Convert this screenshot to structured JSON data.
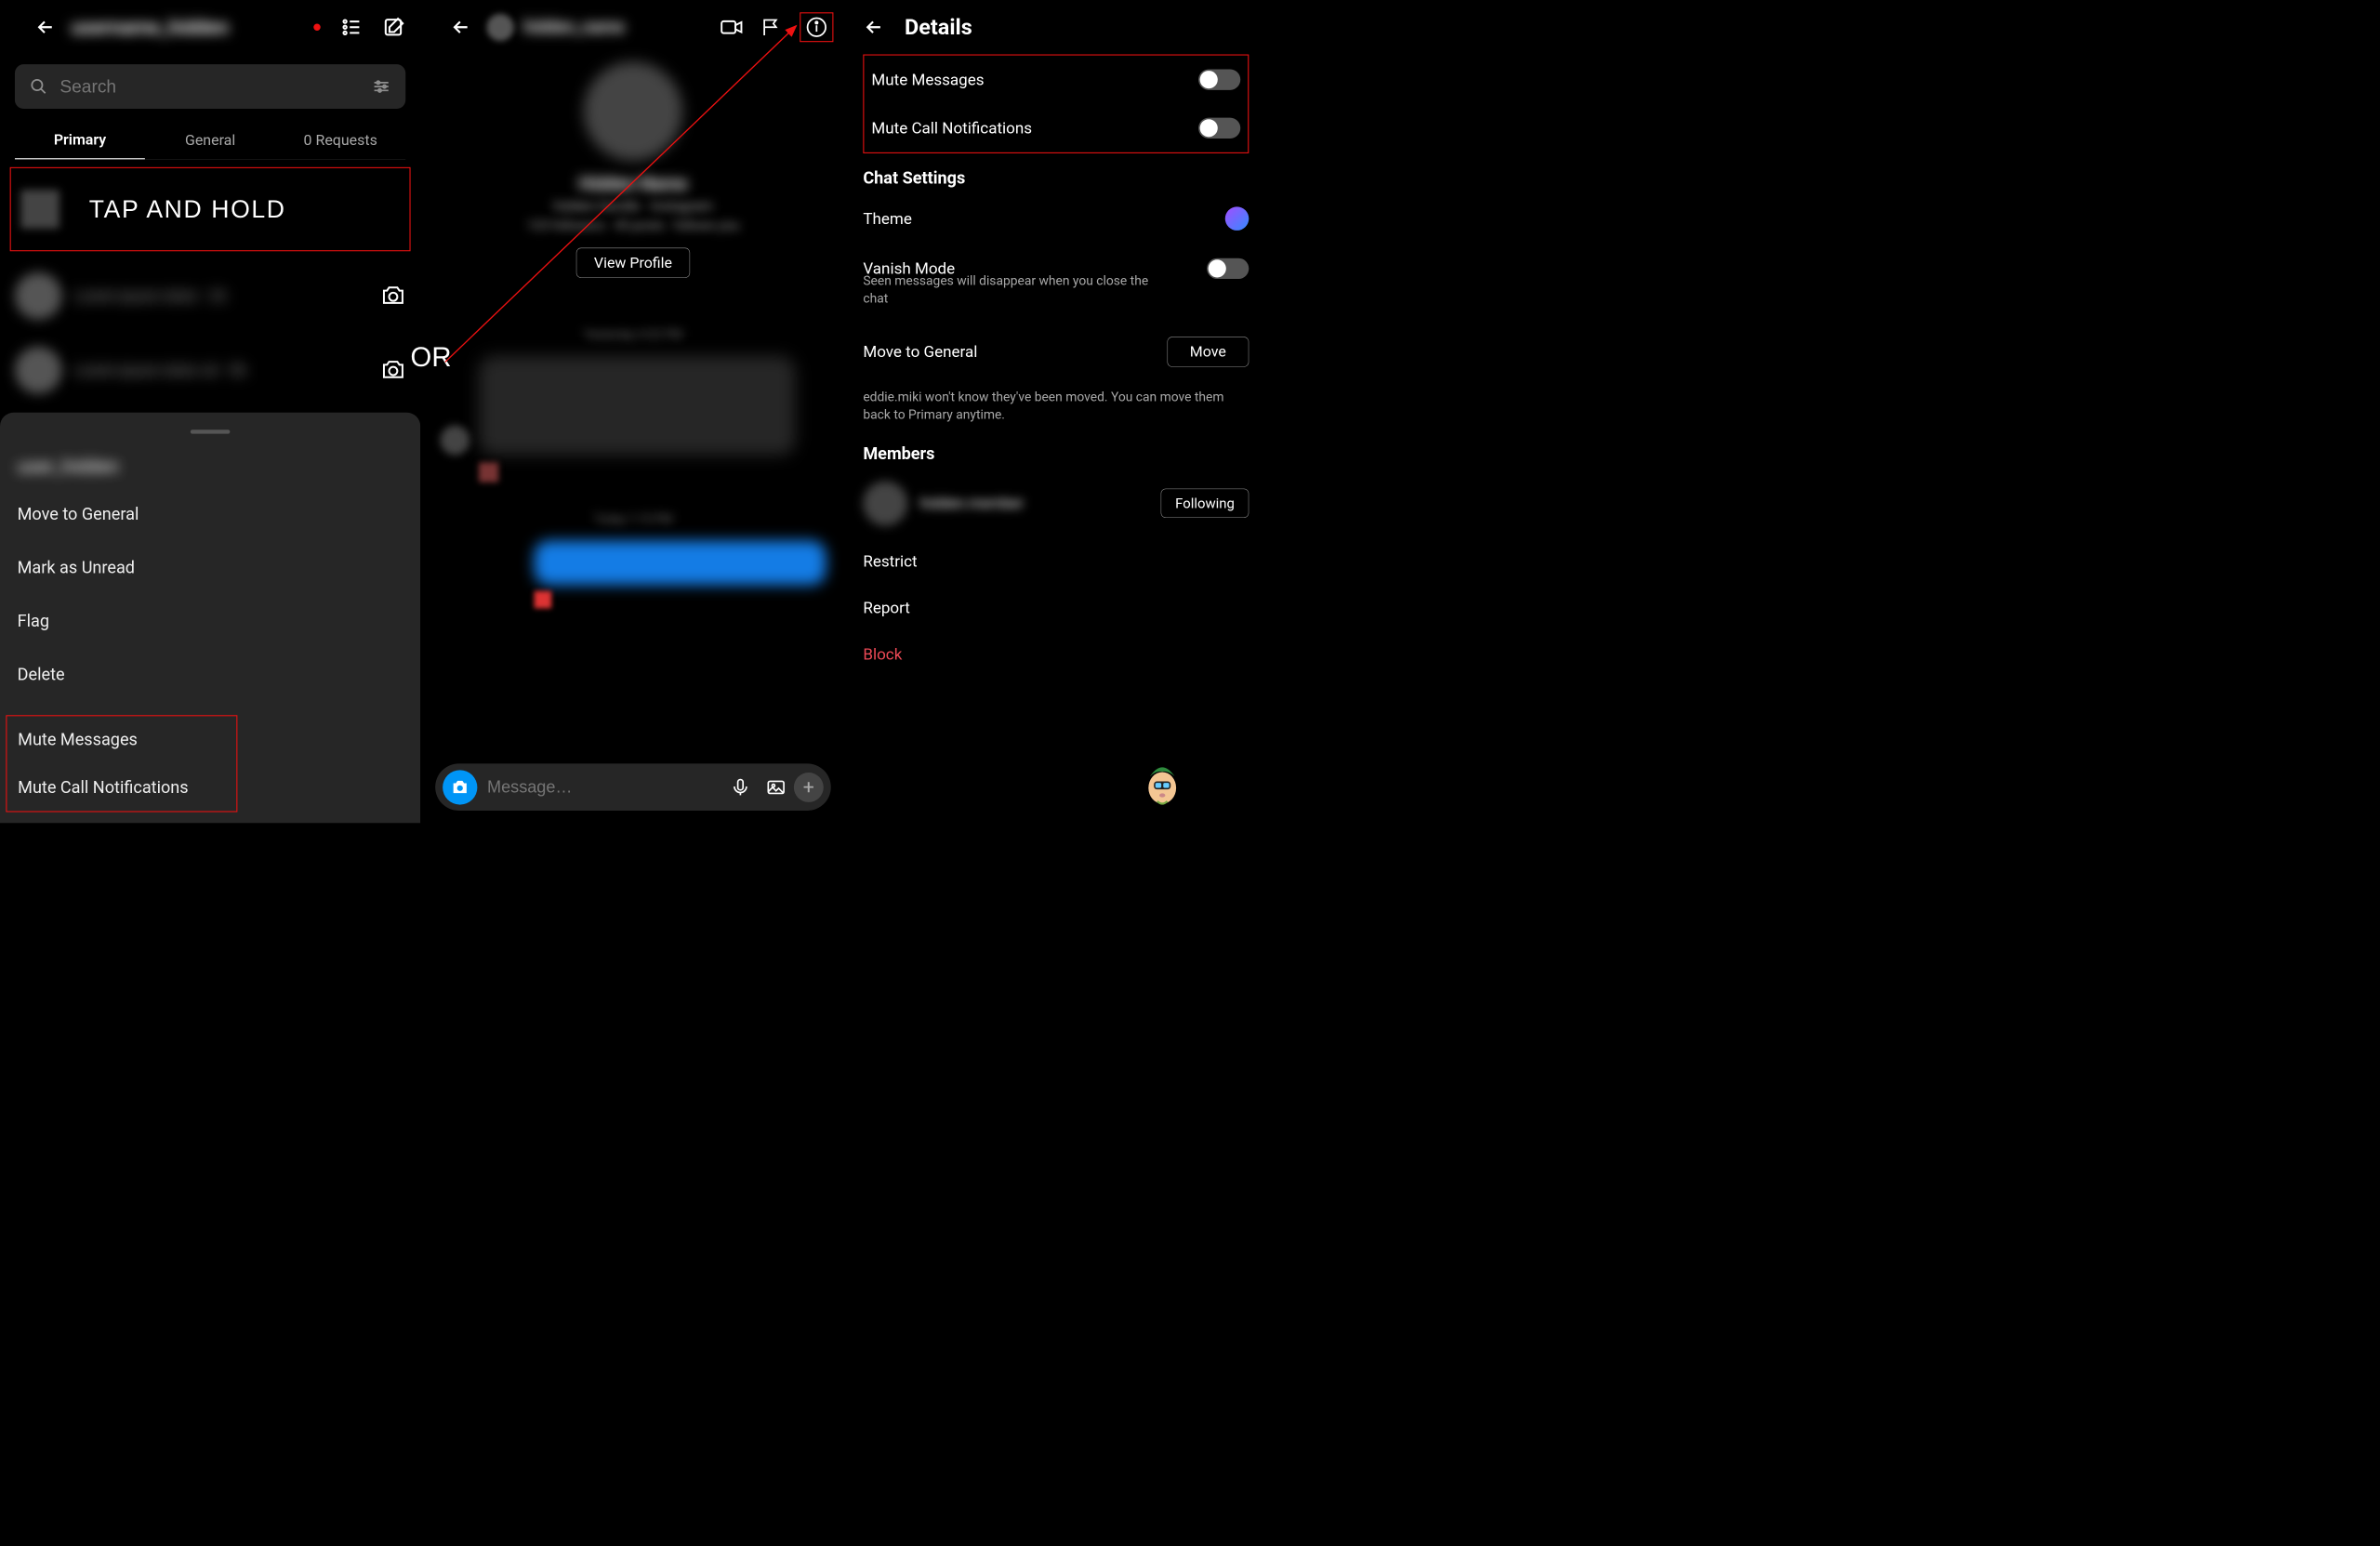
{
  "panel1": {
    "account_name": "username_hidden",
    "search_placeholder": "Search",
    "tabs": {
      "primary": "Primary",
      "general": "General",
      "requests": "0 Requests"
    },
    "tap_hold": "TAP AND HOLD",
    "sheet": {
      "user": "user_hidden",
      "move_general": "Move to General",
      "mark_unread": "Mark as Unread",
      "flag": "Flag",
      "delete": "Delete",
      "mute_messages": "Mute Messages",
      "mute_calls": "Mute Call Notifications"
    }
  },
  "panel2": {
    "chat_name": "hidden_name",
    "view_profile": "View Profile",
    "composer_placeholder": "Message…"
  },
  "panel3": {
    "title": "Details",
    "mute_messages": "Mute Messages",
    "mute_calls": "Mute Call Notifications",
    "chat_settings": "Chat Settings",
    "theme": "Theme",
    "vanish": "Vanish Mode",
    "vanish_sub": "Seen messages will disappear when you close the chat",
    "move_general": "Move to General",
    "move_btn": "Move",
    "move_desc": "eddie.miki won't know they've been moved. You can move them back to Primary anytime.",
    "members": "Members",
    "following": "Following",
    "restrict": "Restrict",
    "report": "Report",
    "block": "Block"
  },
  "or_label": "OR"
}
